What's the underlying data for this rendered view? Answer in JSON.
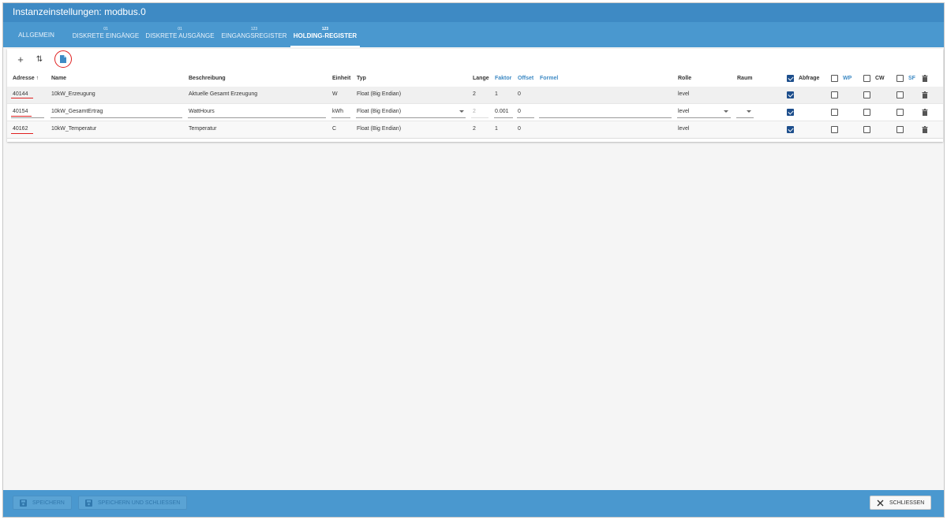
{
  "window": {
    "title": "Instanzeinstellungen: modbus.0"
  },
  "tabs": [
    {
      "sup": "",
      "label": "Allgemein"
    },
    {
      "sup": "01",
      "label": "Diskrete Eingänge"
    },
    {
      "sup": "01",
      "label": "Diskrete Ausgänge"
    },
    {
      "sup": "123",
      "label": "Eingangsregister"
    },
    {
      "sup": "123",
      "label": "Holding-Register"
    }
  ],
  "active_tab": "Holding-Register",
  "toolbar": {
    "add": "+",
    "sort": "⇅"
  },
  "headers": {
    "address": "Adresse",
    "name": "Name",
    "description": "Beschreibung",
    "unit": "Einheit",
    "type": "Typ",
    "length": "Lange",
    "factor": "Faktor",
    "offset": "Offset",
    "formula": "Formel",
    "role": "Rolle",
    "room": "Raum",
    "poll": "Abfrage",
    "wp": "WP",
    "cw": "CW",
    "sf": "SF"
  },
  "header_checks": {
    "poll": true,
    "wp": false,
    "cw": false,
    "sf": false
  },
  "rows": [
    {
      "address": "40144",
      "name": "10kW_Erzeugung",
      "description": "Aktuelle Gesamt Erzeugung",
      "unit": "W",
      "type": "Float (Big Endian)",
      "length": "2",
      "factor": "1",
      "offset": "0",
      "role": "level",
      "poll": true,
      "wp": false,
      "cw": false,
      "sf": false
    },
    {
      "address": "40154",
      "name": "10kW_GesamtErtrag",
      "description": "WattHours",
      "unit": "kWh",
      "type": "Float (Big Endian)",
      "length": "2",
      "factor": "0.001",
      "offset": "0",
      "role": "level",
      "poll": true,
      "wp": false,
      "cw": false,
      "sf": false
    },
    {
      "address": "40162",
      "name": "10kW_Temperatur",
      "description": "Temperatur",
      "unit": "C",
      "type": "Float (Big Endian)",
      "length": "2",
      "factor": "1",
      "offset": "0",
      "role": "level",
      "poll": true,
      "wp": false,
      "cw": false,
      "sf": false
    }
  ],
  "footer": {
    "save": "Speichern",
    "save_close": "Speichern und schliessen",
    "close": "Schliessen"
  },
  "colors": {
    "accent": "#4a98cf",
    "title_bg": "#3e8ac4",
    "checkbox_on": "#1d4e8c",
    "annotation": "#e02020"
  }
}
